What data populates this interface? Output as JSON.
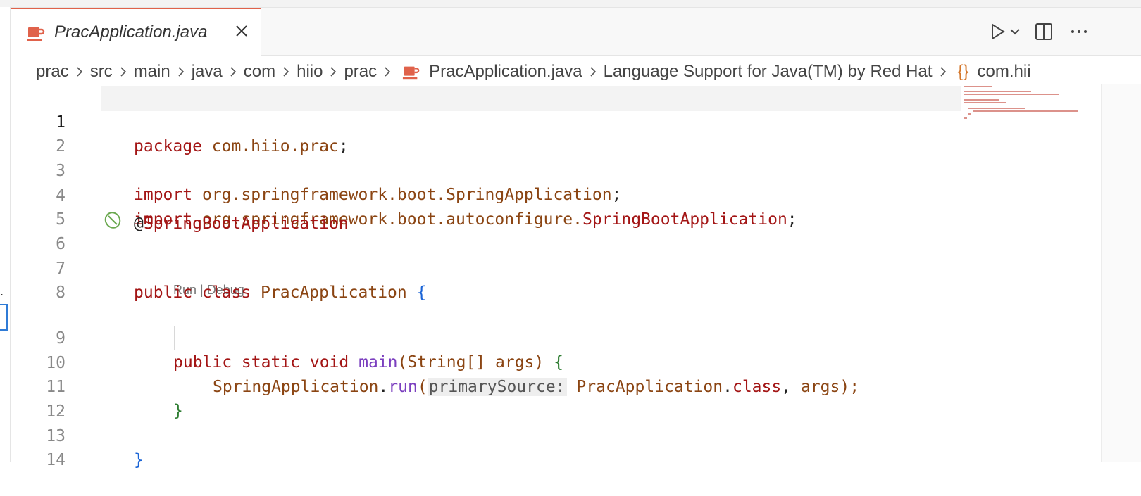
{
  "tab": {
    "label": "PracApplication.java",
    "close_icon": "close-icon",
    "file_icon": "java-cup-icon"
  },
  "actions": {
    "run_icon": "play-icon",
    "run_dropdown_icon": "chevron-down-icon",
    "split_icon": "split-editor-icon",
    "more_icon": "more-icon"
  },
  "breadcrumb": {
    "items": [
      "prac",
      "src",
      "main",
      "java",
      "com",
      "hiio",
      "prac"
    ],
    "file": "PracApplication.java",
    "language": "Language Support for Java(TM) by Red Hat",
    "symbol_icon": "{}",
    "symbol": "com.hii"
  },
  "codelens": {
    "text": "Run | Debug"
  },
  "lines": [
    "1",
    "2",
    "3",
    "4",
    "5",
    "6",
    "7",
    "8",
    "9",
    "10",
    "11",
    "12",
    "13",
    "14"
  ],
  "code": {
    "l1_kw": "package",
    "l1_pkg": "com.hiio.prac",
    "l1_end": ";",
    "l3_kw": "import",
    "l3_pkg": "org.springframework.boot.",
    "l3_cls": "SpringApplication",
    "l3_end": ";",
    "l4_kw": "import",
    "l4_pkg": "org.springframework.boot.autoconfigure.",
    "l4_cls": "SpringBootApplication",
    "l4_end": ";",
    "l6_at": "@",
    "l6_ann": "SpringBootApplication",
    "l7_mod": "public class",
    "l7_cls": "PracApplication",
    "l7_brace": "{",
    "l9_mod": "public static void",
    "l9_fn": "main",
    "l9_p1": "(",
    "l9_type": "String[]",
    "l9_arg": "args",
    "l9_p2": ")",
    "l9_brace": "{",
    "l10_cls": "SpringApplication",
    "l10_dot": ".",
    "l10_fn": "run",
    "l10_p1": "(",
    "l10_hint": "primarySource:",
    "l10_ref": "PracApplication",
    "l10_dot2": ".",
    "l10_kw": "class",
    "l10_comma": ",",
    "l10_arg": "args",
    "l10_end": ");",
    "l11_brace": "}",
    "l13_brace": "}"
  },
  "colors": {
    "keyword": "#a31515",
    "package": "#8b4513",
    "function": "#7b3fbf",
    "bracket_green": "#2e7d32",
    "bracket_blue": "#1a64d6",
    "tab_accent": "#e0624b"
  }
}
